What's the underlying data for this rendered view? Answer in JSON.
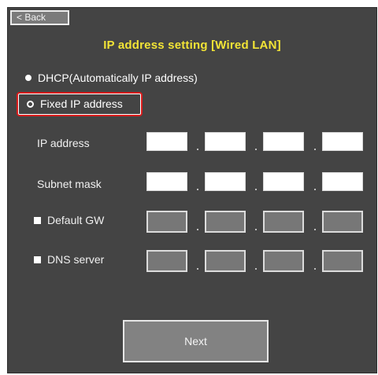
{
  "header": {
    "back_label": "< Back",
    "title": "IP address setting [Wired LAN]"
  },
  "mode": {
    "dhcp_label": "DHCP(Automatically IP address)",
    "fixed_label": "Fixed IP address",
    "selected": "fixed"
  },
  "fields": {
    "ip_address_label": "IP address",
    "subnet_mask_label": "Subnet mask",
    "default_gw_label": "Default GW",
    "dns_server_label": "DNS server",
    "separator": "."
  },
  "footer": {
    "next_label": "Next"
  },
  "colors": {
    "panel_bg": "#444444",
    "title": "#f2e436",
    "highlight": "#d81b1b"
  }
}
